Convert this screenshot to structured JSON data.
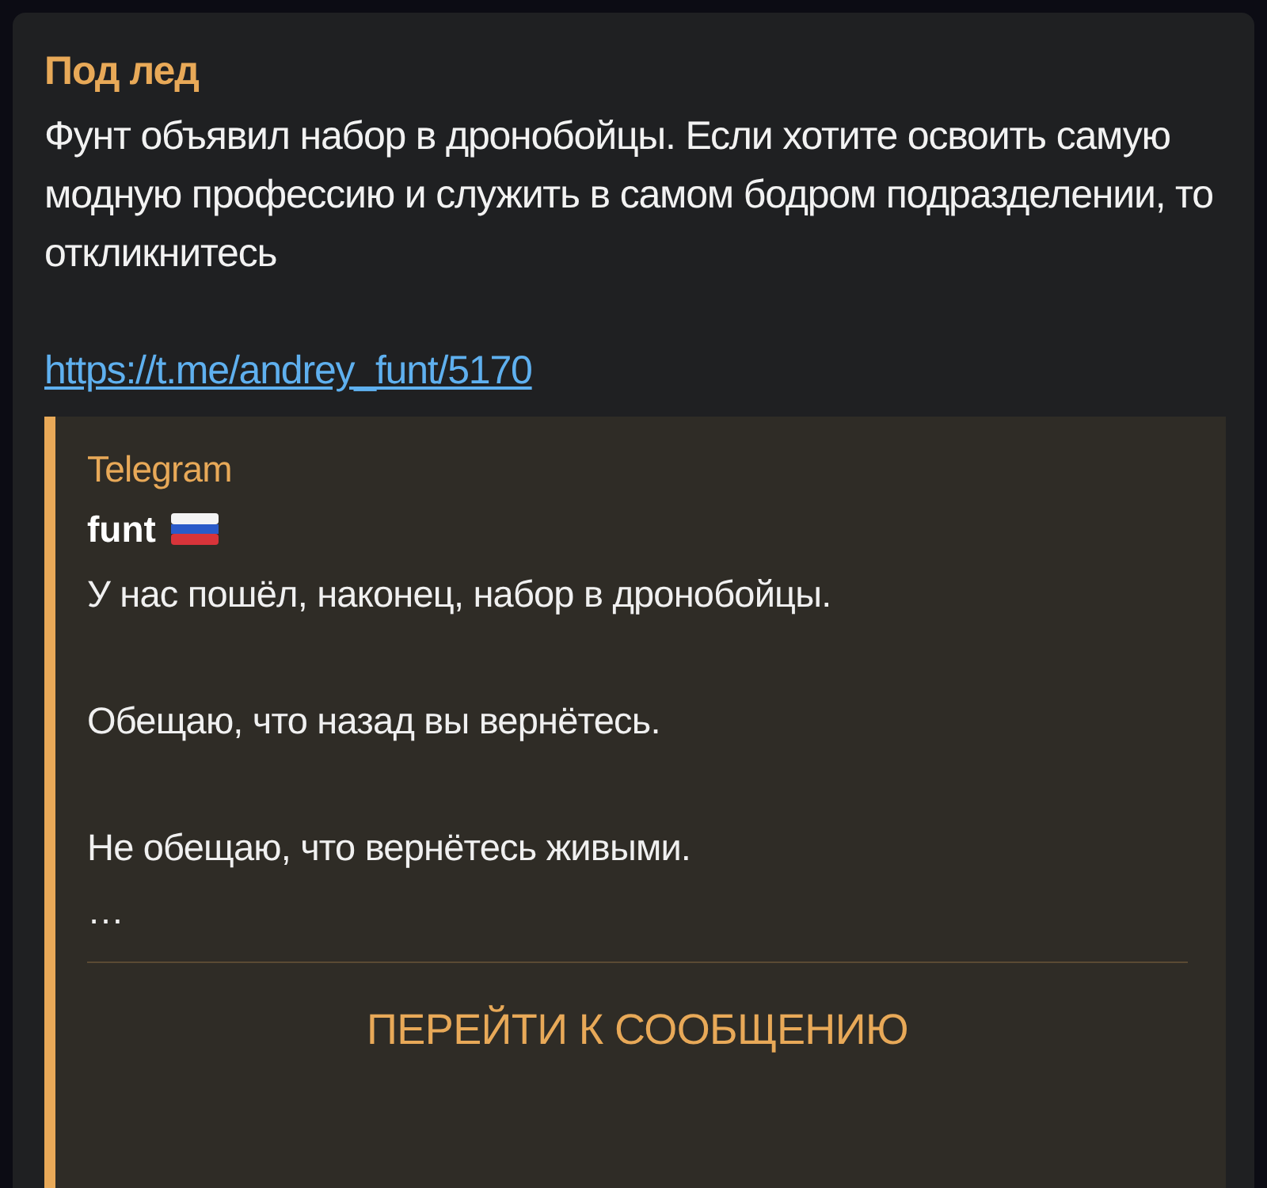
{
  "message": {
    "sender": "Под лед",
    "text": "Фунт объявил набор в дронобойцы. Если хотите освоить самую модную профессию и служить в самом бодром подразделении, то откликнитесь",
    "link": "https://t.me/andrey_funt/5170"
  },
  "preview": {
    "site": "Telegram",
    "author": "funt",
    "text": "У нас пошёл, наконец, набор в дронобойцы.\n\nОбещаю, что назад вы вернётесь.\n\nНе обещаю, что вернётесь живыми.\n…",
    "button": "ПЕРЕЙТИ К СООБЩЕНИЮ"
  }
}
